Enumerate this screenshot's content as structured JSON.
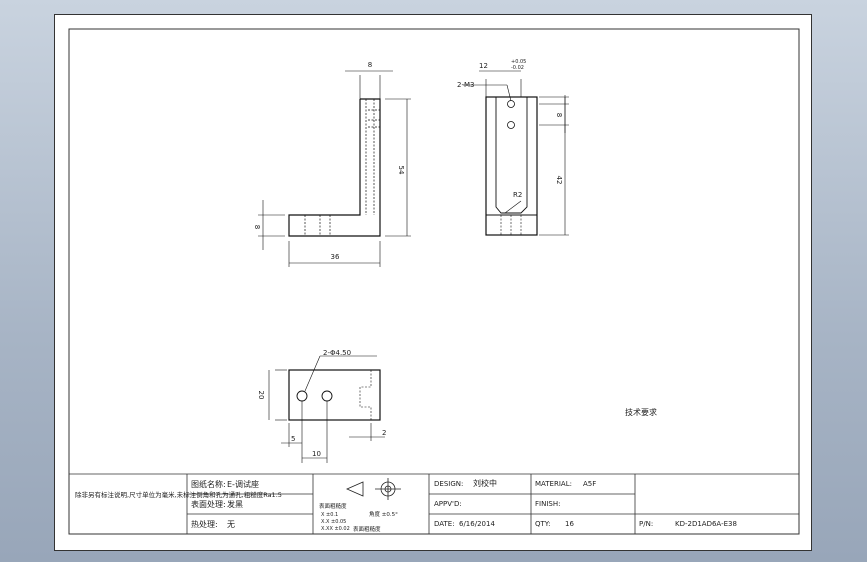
{
  "drawing": {
    "dims": {
      "side_top_width": "8",
      "side_height": "54",
      "side_foot_height": "8",
      "side_length": "36",
      "front_width": "12",
      "front_tol_upper": "+0.05",
      "front_tol_lower": "-0.02",
      "front_thread": "2-M3",
      "front_hole_pitch": "8",
      "front_height": "42",
      "front_radius": "R2",
      "plan_holes": "2-Φ4.50",
      "plan_depth": "20",
      "plan_first": "5",
      "plan_pitch": "10",
      "plan_edge": "2"
    },
    "tech_requirements": "技术要求"
  },
  "title_block": {
    "note": "除非另有标注说明,尺寸单位为毫米,未标注倒角和孔为通孔,粗糙度Ra1.5",
    "part_name_label": "图纸名称:",
    "part_name": "E-调试座",
    "surface_label": "表面处理:",
    "surface_value": "发黑",
    "heat_label": "热处理:",
    "heat_value": "无",
    "roughness_label": "表面粗糙度",
    "tolerance_label": "公差",
    "tol_lines": [
      "X ±0.1",
      "X.X ±0.05",
      "X.XX ±0.02"
    ],
    "tol_right": "角度 ±0.5°",
    "surface_general": "表面粗糙度",
    "design_label": "DESIGN:",
    "design_value": "刘校中",
    "material_label": "MATERIAL:",
    "material_value": "A5F",
    "approved_label": "APPV'D:",
    "finish_label": "FINISH:",
    "date_label": "DATE:",
    "date_value": "6/16/2014",
    "qty_label": "QTY:",
    "qty_value": "16",
    "pn_label": "P/N:",
    "pn_value": "KD-2D1AD6A-E38"
  }
}
